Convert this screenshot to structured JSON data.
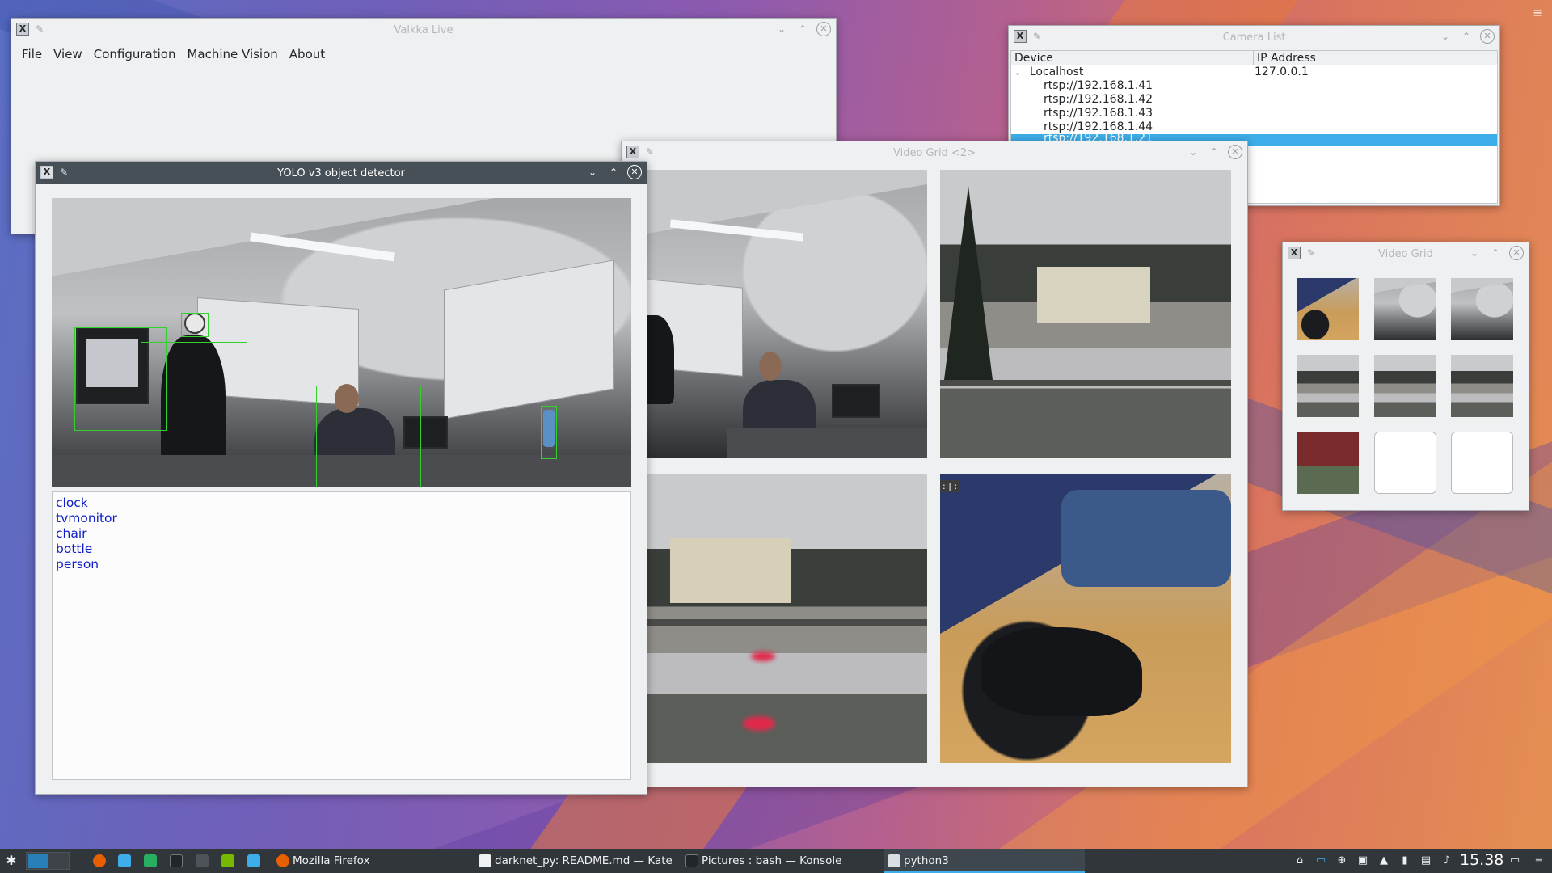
{
  "valkka": {
    "title": "Valkka Live",
    "menu": [
      "File",
      "View",
      "Configuration",
      "Machine Vision",
      "About"
    ]
  },
  "camera_list": {
    "title": "Camera List",
    "columns": [
      "Device",
      "IP Address"
    ],
    "root": {
      "device": "Localhost",
      "ip": "127.0.0.1"
    },
    "streams": [
      "rtsp://192.168.1.41",
      "rtsp://192.168.1.42",
      "rtsp://192.168.1.43",
      "rtsp://192.168.1.44",
      "rtsp://192.168.1.21"
    ],
    "selected_index": 4
  },
  "video_grid_2": {
    "title": "Video Grid <2>",
    "tile_label": ": | :"
  },
  "yolo": {
    "title": "YOLO v3 object detector",
    "detections": [
      "clock",
      "tvmonitor",
      "chair",
      "bottle",
      "person"
    ]
  },
  "video_grid_small": {
    "title": "Video Grid"
  },
  "taskbar": {
    "tasks": [
      "Mozilla Firefox",
      "darknet_py: README.md — Kate",
      "Pictures : bash — Konsole",
      "python3"
    ],
    "active_task": "python3",
    "clock": "15.38"
  },
  "colors": {
    "titlebar_active": "#475057",
    "selection": "#3daee9",
    "bbox": "#31d22c",
    "label_text": "#0f1ec8",
    "taskbar": "#31363b"
  }
}
